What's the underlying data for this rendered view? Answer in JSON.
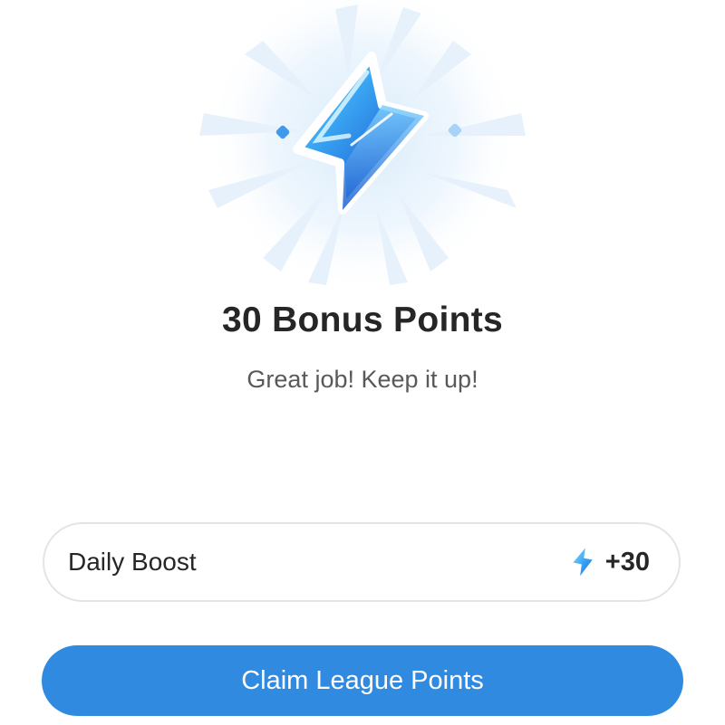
{
  "reward": {
    "title": "30 Bonus Points",
    "subtitle": "Great job! Keep it up!",
    "icon": "lightning-bolt-icon"
  },
  "boost_item": {
    "label": "Daily Boost",
    "icon": "lightning-bolt-icon",
    "value": "+30"
  },
  "cta": {
    "label": "Claim League Points"
  },
  "colors": {
    "accent": "#2f8ae0",
    "bolt_light": "#8fd8ff",
    "bolt_dark": "#1f63d6",
    "text_primary": "#262626",
    "text_secondary": "#595959",
    "card_border": "#e4e4e4"
  }
}
